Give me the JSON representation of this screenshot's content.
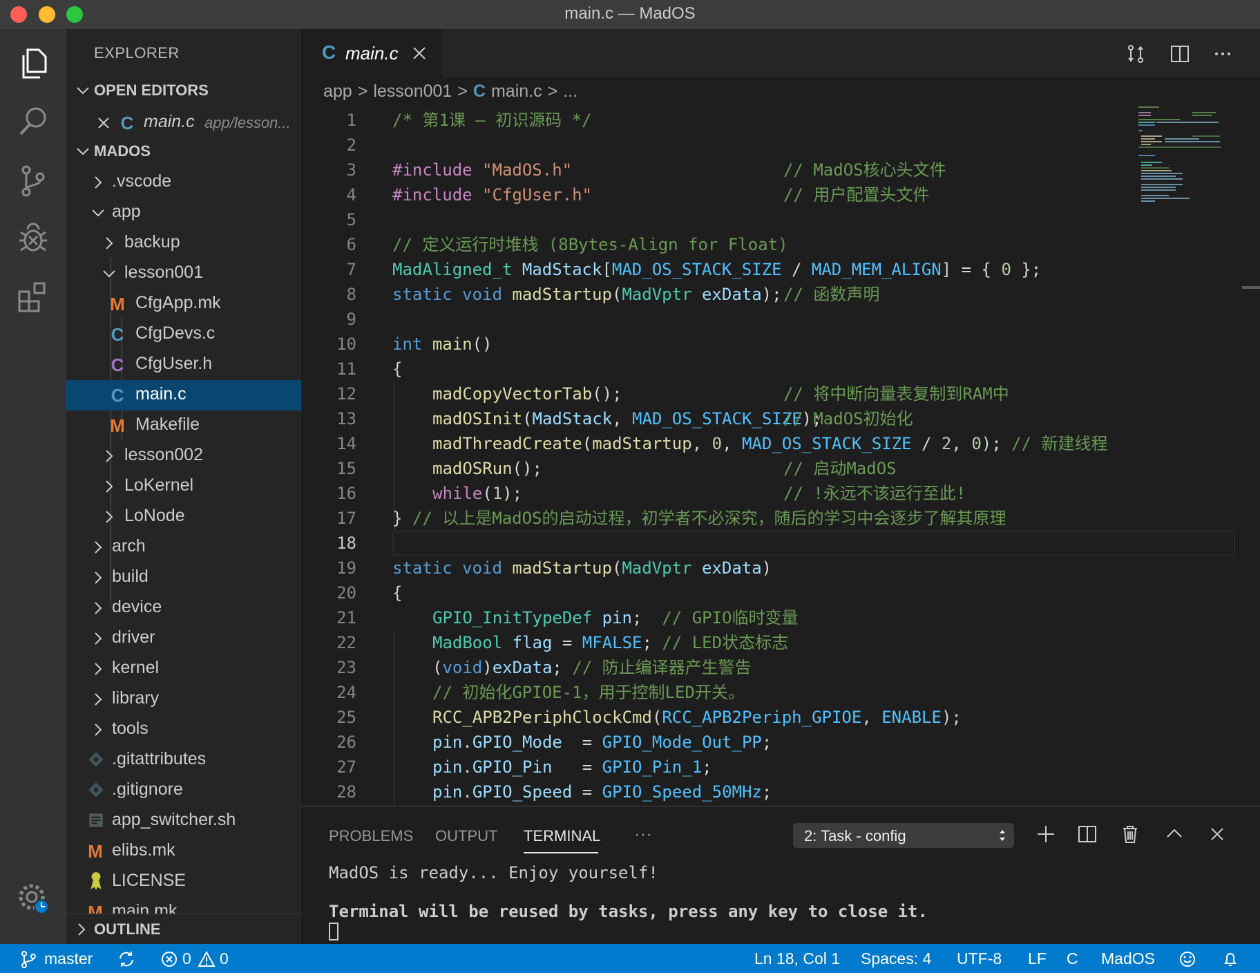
{
  "window": {
    "title": "main.c — MadOS"
  },
  "explorer": {
    "header": "EXPLORER",
    "open_editors_label": "OPEN EDITORS",
    "open_editor": {
      "name": "main.c",
      "path": "app/lesson..."
    },
    "project_label": "MADOS",
    "outline_label": "OUTLINE",
    "tree": [
      {
        "name": ".vscode"
      },
      {
        "name": "app"
      },
      {
        "name": "backup"
      },
      {
        "name": "lesson001"
      },
      {
        "name": "CfgApp.mk",
        "icon": "M"
      },
      {
        "name": "CfgDevs.c",
        "icon": "C"
      },
      {
        "name": "CfgUser.h",
        "icon": "C"
      },
      {
        "name": "main.c",
        "icon": "C"
      },
      {
        "name": "Makefile",
        "icon": "M"
      },
      {
        "name": "lesson002"
      },
      {
        "name": "LoKernel"
      },
      {
        "name": "LoNode"
      },
      {
        "name": "arch"
      },
      {
        "name": "build"
      },
      {
        "name": "device"
      },
      {
        "name": "driver"
      },
      {
        "name": "kernel"
      },
      {
        "name": "library"
      },
      {
        "name": "tools"
      },
      {
        "name": ".gitattributes"
      },
      {
        "name": ".gitignore"
      },
      {
        "name": "app_switcher.sh"
      },
      {
        "name": "elibs.mk",
        "icon": "M"
      },
      {
        "name": "LICENSE"
      },
      {
        "name": "main.mk",
        "icon": "M"
      }
    ]
  },
  "editor": {
    "tab": {
      "name": "main.c",
      "icon": "C"
    },
    "breadcrumb": {
      "p1": "app",
      "p2": "lesson001",
      "icon": "C",
      "p3": "main.c",
      "p4": "..."
    },
    "line_numbers": [
      "1",
      "2",
      "3",
      "4",
      "5",
      "6",
      "7",
      "8",
      "9",
      "10",
      "11",
      "12",
      "13",
      "14",
      "15",
      "16",
      "17",
      "18",
      "19",
      "20",
      "21",
      "22",
      "23",
      "24",
      "25",
      "26",
      "27",
      "28"
    ],
    "code": {
      "l1": "/* 第1课 – 初识源码 */",
      "l3a": "#include",
      "l3b": "\"MadOS.h\"",
      "l3c": "// MadOS核心头文件",
      "l4a": "#include",
      "l4b": "\"CfgUser.h\"",
      "l4c": "// 用户配置头文件",
      "l6": "// 定义运行时堆栈 (8Bytes-Align for Float)",
      "l7a": "MadAligned_t",
      "l7b": "MadStack",
      "l7c": "[",
      "l7d": "MAD_OS_STACK_SIZE",
      "l7e": " / ",
      "l7f": "MAD_MEM_ALIGN",
      "l7g": "] = { ",
      "l7h": "0",
      "l7i": " };",
      "l8a": "static",
      "l8b": "void",
      "l8c": "madStartup",
      "l8d": "(",
      "l8e": "MadVptr",
      "l8f": "exData",
      "l8g": ");",
      "l8h": "// 函数声明",
      "l10a": "int",
      "l10b": "main",
      "l10c": "()",
      "l11": "{",
      "l12a": "madCopyVectorTab",
      "l12b": "();",
      "l12c": "// 将中断向量表复制到RAM中",
      "l13a": "madOSInit",
      "l13b": "(",
      "l13c": "MadStack",
      "l13d": ", ",
      "l13e": "MAD_OS_STACK_SIZE",
      "l13f": ");",
      "l13g": "// MadOS初始化",
      "l14a": "madThreadCreate",
      "l14b": "(",
      "l14c": "madStartup",
      "l14d": ", ",
      "l14e": "0",
      "l14f": ", ",
      "l14g": "MAD_OS_STACK_SIZE",
      "l14h": " / ",
      "l14i": "2",
      "l14j": ", ",
      "l14k": "0",
      "l14l": ");",
      "l14m": "// 新建线程",
      "l15a": "madOSRun",
      "l15b": "();",
      "l15c": "// 启动MadOS",
      "l16a": "while",
      "l16b": "(",
      "l16c": "1",
      "l16d": ");",
      "l16e": "// !永远不该运行至此!",
      "l17a": "}",
      "l17b": "// 以上是MadOS的启动过程，初学者不必深究，随后的学习中会逐步了解其原理",
      "l19a": "static",
      "l19b": "void",
      "l19c": "madStartup",
      "l19d": "(",
      "l19e": "MadVptr",
      "l19f": "exData",
      "l19g": ")",
      "l20": "{",
      "l21a": "GPIO_InitTypeDef",
      "l21b": "pin",
      "l21c": ";",
      "l21d": "// GPIO临时变量",
      "l22a": "MadBool",
      "l22b": "flag",
      "l22c": " = ",
      "l22d": "MFALSE",
      "l22e": ";",
      "l22f": "// LED状态标志",
      "l23a": "(",
      "l23b": "void",
      "l23c": ")",
      "l23d": "exData",
      "l23e": ";",
      "l23f": "// 防止编译器产生警告",
      "l24": "// 初始化GPIOE-1，用于控制LED开关。",
      "l25a": "RCC_APB2PeriphClockCmd",
      "l25b": "(",
      "l25c": "RCC_APB2Periph_GPIOE",
      "l25d": ", ",
      "l25e": "ENABLE",
      "l25f": ");",
      "l26a": "pin",
      "l26b": ".",
      "l26c": "GPIO_Mode",
      "l26d": "  = ",
      "l26e": "GPIO_Mode_Out_PP",
      "l26f": ";",
      "l27a": "pin",
      "l27b": ".",
      "l27c": "GPIO_Pin",
      "l27d": "   = ",
      "l27e": "GPIO_Pin_1",
      "l27f": ";",
      "l28a": "pin",
      "l28b": ".",
      "l28c": "GPIO_Speed",
      "l28d": " = ",
      "l28e": "GPIO_Speed_50MHz",
      "l28f": ";"
    }
  },
  "panel": {
    "tabs": [
      "PROBLEMS",
      "OUTPUT",
      "TERMINAL"
    ],
    "more": "···",
    "terminal_select": "2: Task - config",
    "terminal_lines": [
      "MadOS is ready... Enjoy yourself!",
      "Terminal will be reused by tasks, press any key to close it."
    ]
  },
  "statusbar": {
    "branch": "master",
    "errors": "0",
    "warnings": "0",
    "position": "Ln 18, Col 1",
    "spaces": "Spaces: 4",
    "encoding": "UTF-8",
    "eol": "LF",
    "language": "C",
    "project": "MadOS"
  },
  "colors": {
    "accent": "#007acc",
    "selection": "#094771",
    "c_icon": "#519aba",
    "h_icon": "#a074c4",
    "mk_icon": "#e37933"
  }
}
